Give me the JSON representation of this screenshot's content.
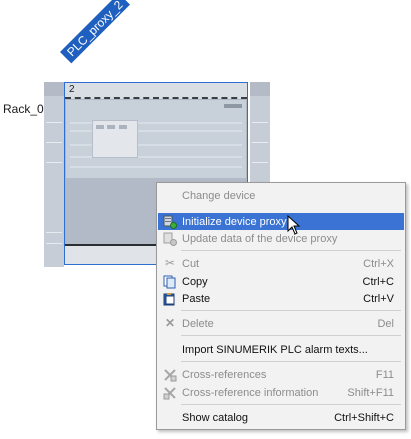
{
  "device": {
    "tag": "PLC_proxy_2",
    "rack_label": "Rack_0",
    "slot_number": "2"
  },
  "context_menu": {
    "items": [
      {
        "label": "Change device",
        "shortcut": "",
        "icon": "",
        "disabled": true
      },
      {
        "label": "Initialize device proxy",
        "shortcut": "",
        "icon": "initialize-proxy-icon",
        "disabled": false,
        "highlighted": true
      },
      {
        "label": "Update data of the device proxy",
        "shortcut": "",
        "icon": "update-proxy-icon",
        "disabled": true
      },
      {
        "label": "Cut",
        "shortcut": "Ctrl+X",
        "icon": "scissors-icon",
        "disabled": true
      },
      {
        "label": "Copy",
        "shortcut": "Ctrl+C",
        "icon": "copy-icon",
        "disabled": false
      },
      {
        "label": "Paste",
        "shortcut": "Ctrl+V",
        "icon": "paste-icon",
        "disabled": false
      },
      {
        "label": "Delete",
        "shortcut": "Del",
        "icon": "delete-x-icon",
        "disabled": true
      },
      {
        "label": "Import SINUMERIK PLC alarm texts...",
        "shortcut": "",
        "icon": "",
        "disabled": false
      },
      {
        "label": "Cross-references",
        "shortcut": "F11",
        "icon": "cross-references-icon",
        "disabled": true
      },
      {
        "label": "Cross-reference information",
        "shortcut": "Shift+F11",
        "icon": "cross-reference-info-icon",
        "disabled": true
      },
      {
        "label": "Show catalog",
        "shortcut": "Ctrl+Shift+C",
        "icon": "",
        "disabled": false
      }
    ]
  },
  "colors": {
    "highlight": "#3b73d4",
    "selection_border": "#2d6fd1",
    "tag_background": "#1f5fbf"
  }
}
